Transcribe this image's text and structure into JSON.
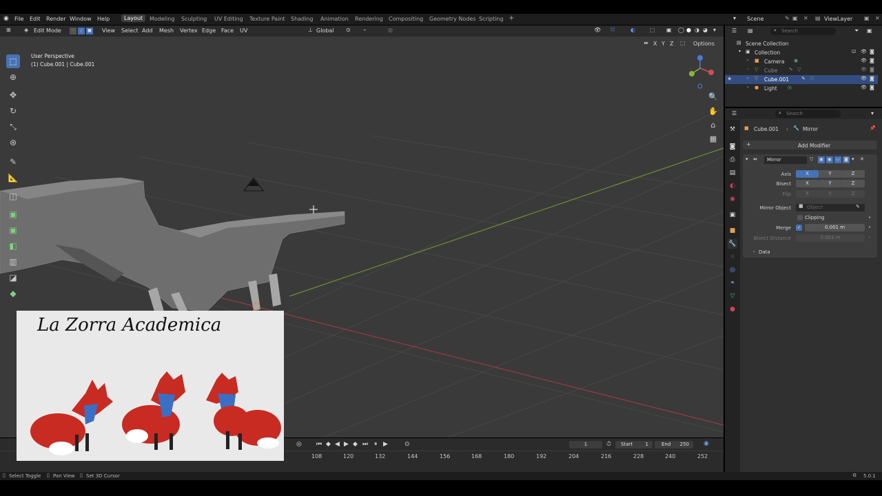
{
  "topbar": {
    "menus": [
      "File",
      "Edit",
      "Render",
      "Window",
      "Help"
    ],
    "workspaces": [
      "Layout",
      "Modeling",
      "Sculpting",
      "UV Editing",
      "Texture Paint",
      "Shading",
      "Animation",
      "Rendering",
      "Compositing",
      "Geometry Nodes",
      "Scripting"
    ],
    "add_tab": "+",
    "scene_label": "Scene",
    "viewlayer_label": "ViewLayer"
  },
  "viewport_header": {
    "mode": "Edit Mode",
    "menus": [
      "View",
      "Select",
      "Add",
      "Mesh",
      "Vertex",
      "Edge",
      "Face",
      "UV"
    ],
    "orientation": "Global",
    "options": "Options",
    "axis_x": "X",
    "axis_y": "Y",
    "axis_z": "Z"
  },
  "viewport": {
    "perspective": "User Perspective",
    "object_info": "(1) Cube.001 | Cube.001"
  },
  "overlay": {
    "title": "La Zorra Academica"
  },
  "timeline": {
    "current_frame": "1",
    "start_label": "Start",
    "start_value": "1",
    "end_label": "End",
    "end_value": "250",
    "ticks": [
      "108",
      "120",
      "132",
      "144",
      "156",
      "168",
      "180",
      "192",
      "204",
      "216",
      "228",
      "240",
      "252"
    ]
  },
  "statusbar": {
    "items": [
      "Select Toggle",
      "Pan View",
      "Set 3D Cursor"
    ],
    "version": "5.0.1"
  },
  "outliner": {
    "search_placeholder": "Search",
    "root": "Scene Collection",
    "collection": "Collection",
    "items": [
      {
        "name": "Camera",
        "selected": false,
        "dim": false
      },
      {
        "name": "Cube",
        "selected": false,
        "dim": true
      },
      {
        "name": "Cube.001",
        "selected": true,
        "dim": false
      },
      {
        "name": "Light",
        "selected": false,
        "dim": false
      }
    ]
  },
  "properties": {
    "search_placeholder": "Search",
    "breadcrumb_object": "Cube.001",
    "breadcrumb_modifier": "Mirror",
    "add_modifier": "Add Modifier",
    "modifier_name": "Mirror",
    "axis_label": "Axis",
    "bisect_label": "Bisect",
    "flip_label": "Flip",
    "x": "X",
    "y": "Y",
    "z": "Z",
    "mirror_object_label": "Mirror Object",
    "object_placeholder": "Object",
    "clipping_label": "Clipping",
    "merge_label": "Merge",
    "merge_value": "0.001 m",
    "bisect_distance_label": "Bisect Distance",
    "bisect_distance_value": "0.001 m",
    "data_label": "Data"
  },
  "colors": {
    "accent": "#4772b3",
    "x_axis": "#c8404f",
    "y_axis": "#7aa33b",
    "viewport_bg": "#3a3a3a"
  }
}
